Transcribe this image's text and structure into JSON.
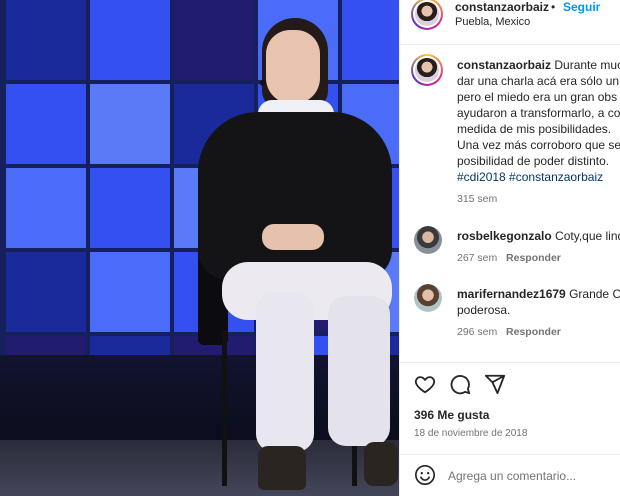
{
  "post": {
    "username": "constanzaorbaiz",
    "separator": "•",
    "follow_label": "Seguir",
    "location": "Puebla, Mexico"
  },
  "caption": {
    "username": "constanzaorbaiz",
    "lines": [
      "Durante mucho",
      "dar una charla acá era sólo un",
      "pero el miedo era un gran obs",
      "ayudaron a transformarlo, a co",
      "medida de mis posibilidades.",
      "Una vez más corroboro que se",
      "posibilidad de poder distinto."
    ],
    "hashtags": "#cdi2018 #constanzaorbaiz",
    "time": "315 sem"
  },
  "comments": [
    {
      "username": "rosbelkegonzalo",
      "text": "Coty,que lind",
      "time": "267 sem",
      "reply_label": "Responder"
    },
    {
      "username": "marifernandez1679",
      "text": "Grande C",
      "text_line2": "poderosa.",
      "time": "296 sem",
      "reply_label": "Responder"
    }
  ],
  "footer": {
    "likes": "396 Me gusta",
    "date": "18 de noviembre de 2018",
    "comment_placeholder": "Agrega un comentario..."
  },
  "icons": {
    "like": "heart-icon",
    "comment": "comment-bubble-icon",
    "share": "paper-plane-icon",
    "emoji": "smiley-icon"
  },
  "colors": {
    "link_blue": "#0095f6",
    "hashtag": "#00376b",
    "muted": "#737373",
    "text": "#262626"
  }
}
